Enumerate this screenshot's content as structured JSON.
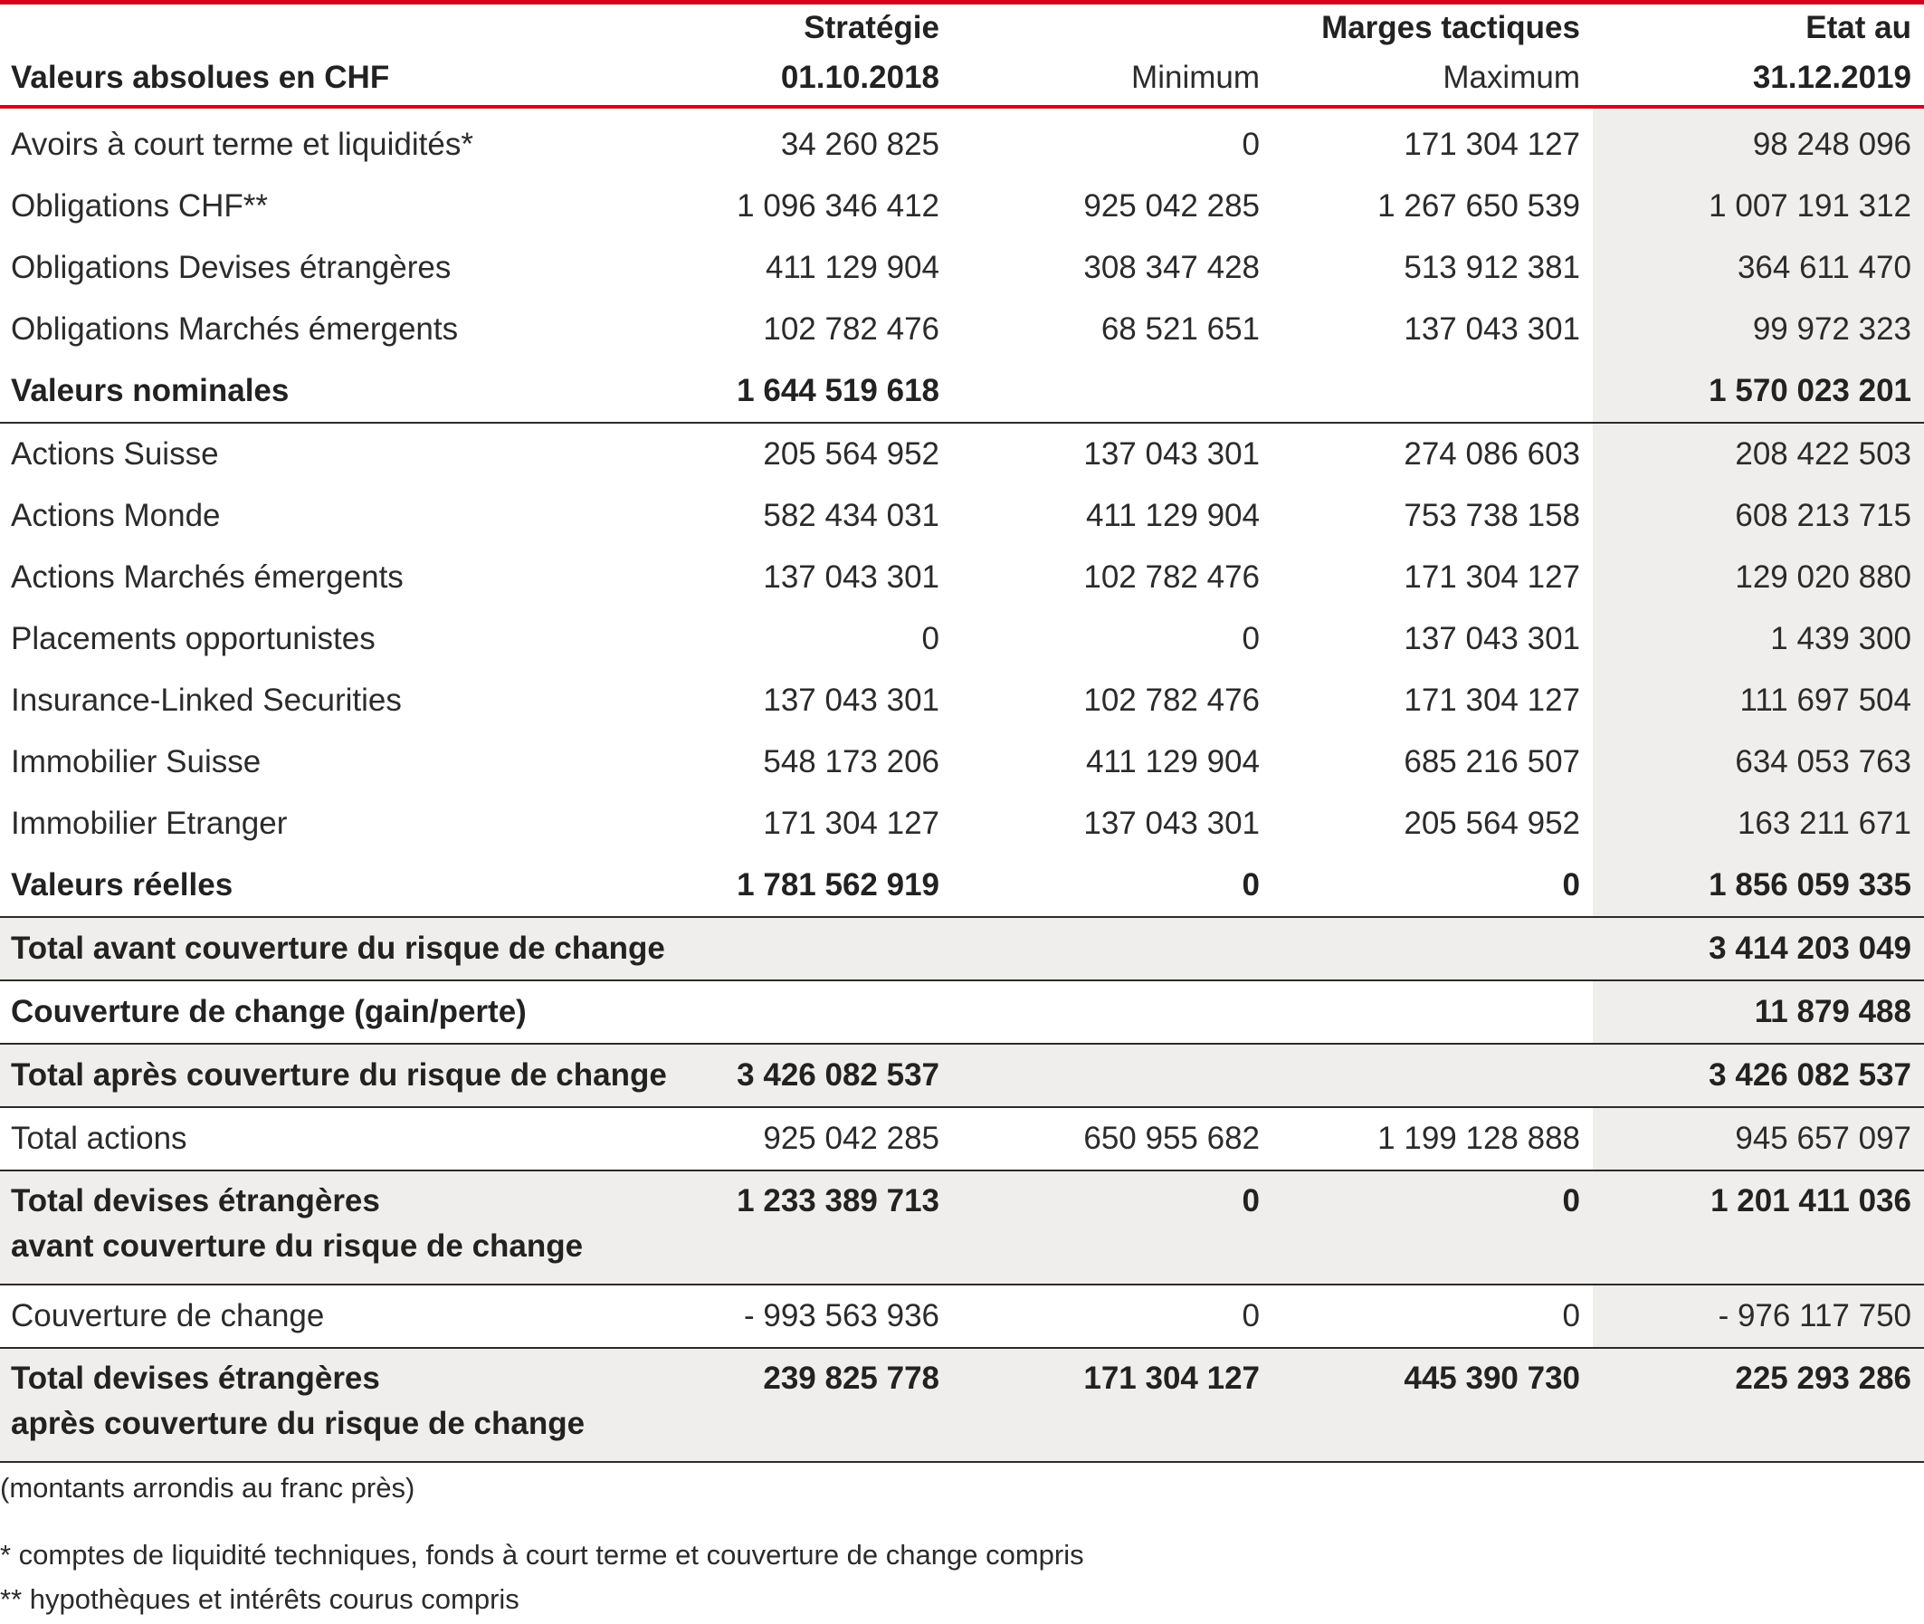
{
  "header": {
    "label": "Valeurs absolues en CHF",
    "strategie_line1": "Stratégie",
    "strategie_line2": "01.10.2018",
    "marges": "Marges tactiques",
    "minimum": "Minimum",
    "maximum": "Maximum",
    "etat_line1": "Etat au",
    "etat_line2": "31.12.2019"
  },
  "rows": [
    {
      "label": "Avoirs à court terme et liquidités*",
      "strategie": "34 260 825",
      "minimum": "0",
      "maximum": "171 304 127",
      "etat": "98 248 096"
    },
    {
      "label": "Obligations CHF**",
      "strategie": "1 096 346 412",
      "minimum": "925 042 285",
      "maximum": "1 267 650 539",
      "etat": "1 007 191 312"
    },
    {
      "label": "Obligations Devises étrangères",
      "strategie": "411 129 904",
      "minimum": "308 347 428",
      "maximum": "513 912 381",
      "etat": "364 611 470"
    },
    {
      "label": "Obligations Marchés émergents",
      "strategie": "102 782 476",
      "minimum": "68 521 651",
      "maximum": "137 043 301",
      "etat": "99 972 323"
    },
    {
      "label": "Valeurs nominales",
      "strategie": "1 644 519 618",
      "minimum": "",
      "maximum": "",
      "etat": "1 570 023 201"
    },
    {
      "label": "Actions Suisse",
      "strategie": "205 564 952",
      "minimum": "137 043 301",
      "maximum": "274 086 603",
      "etat": "208 422 503"
    },
    {
      "label": "Actions Monde",
      "strategie": "582 434 031",
      "minimum": "411 129 904",
      "maximum": "753 738 158",
      "etat": "608 213 715"
    },
    {
      "label": "Actions Marchés émergents",
      "strategie": "137 043 301",
      "minimum": "102 782 476",
      "maximum": "171 304 127",
      "etat": "129 020 880"
    },
    {
      "label": "Placements opportunistes",
      "strategie": "0",
      "minimum": "0",
      "maximum": "137 043 301",
      "etat": "1 439 300"
    },
    {
      "label": "Insurance-Linked Securities",
      "strategie": "137 043 301",
      "minimum": "102 782 476",
      "maximum": "171 304 127",
      "etat": "111 697 504"
    },
    {
      "label": "Immobilier Suisse",
      "strategie": "548 173 206",
      "minimum": "411 129 904",
      "maximum": "685 216 507",
      "etat": "634 053 763"
    },
    {
      "label": "Immobilier Etranger",
      "strategie": "171 304 127",
      "minimum": "137 043 301",
      "maximum": "205 564 952",
      "etat": "163 211 671"
    },
    {
      "label": "Valeurs réelles",
      "strategie": "1 781 562 919",
      "minimum": "0",
      "maximum": "0",
      "etat": "1 856 059 335"
    },
    {
      "label": "Total avant couverture du risque de change",
      "strategie": "",
      "minimum": "",
      "maximum": "",
      "etat": "3 414 203 049"
    },
    {
      "label": "Couverture de change (gain/perte)",
      "strategie": "",
      "minimum": "",
      "maximum": "",
      "etat": "11 879 488"
    },
    {
      "label": "Total après couverture du risque de change",
      "strategie": "3 426 082 537",
      "minimum": "",
      "maximum": "",
      "etat": "3 426 082 537"
    },
    {
      "label": "Total actions",
      "strategie": "925 042 285",
      "minimum": "650 955 682",
      "maximum": "1 199 128 888",
      "etat": "945 657 097"
    },
    {
      "label_line1": "Total devises étrangères",
      "label_line2": "avant couverture du risque de change",
      "strategie": "1 233 389 713",
      "minimum": "0",
      "maximum": "0",
      "etat": "1 201 411 036"
    },
    {
      "label": "Couverture de change",
      "strategie": "- 993 563 936",
      "minimum": "0",
      "maximum": "0",
      "etat": "- 976 117 750"
    },
    {
      "label_line1": "Total devises étrangères",
      "label_line2": "après couverture du risque de change",
      "strategie": "239 825 778",
      "minimum": "171 304 127",
      "maximum": "445 390 730",
      "etat": "225 293 286"
    }
  ],
  "notes": {
    "rounding": "(montants arrondis au franc près)",
    "footnote1": "* comptes de liquidité techniques, fonds à court terme et couverture de change compris",
    "footnote2": "** hypothèques et intérêts courus compris"
  },
  "colors": {
    "accent_red": "#d9001b",
    "shade": "#efeeec",
    "text": "#2b2b2b"
  }
}
